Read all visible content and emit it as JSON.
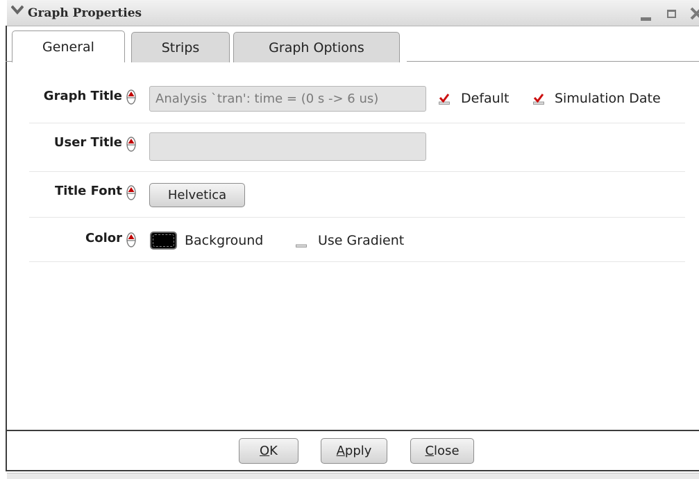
{
  "window": {
    "title": "Graph Properties",
    "menu_icon": "chevron-down-icon",
    "controls": [
      "minimize-icon",
      "maximize-icon",
      "close-icon"
    ]
  },
  "tabs": [
    {
      "label": "General",
      "active": true
    },
    {
      "label": "Strips",
      "active": false
    },
    {
      "label": "Graph Options",
      "active": false
    }
  ],
  "general": {
    "graph_title": {
      "label": "Graph Title",
      "value": "Analysis `tran': time = (0 s -> 6 us)",
      "default_label": "Default",
      "default_checked": true,
      "sim_date_label": "Simulation Date",
      "sim_date_checked": true
    },
    "user_title": {
      "label": "User Title",
      "value": ""
    },
    "title_font": {
      "label": "Title Font",
      "button_label": "Helvetica"
    },
    "color": {
      "label": "Color",
      "swatch": "#000000",
      "background_label": "Background",
      "gradient_label": "Use Gradient",
      "gradient_checked": false
    }
  },
  "buttons": {
    "ok": {
      "prefix": "",
      "underlined": "O",
      "rest": "K"
    },
    "apply": {
      "prefix": "",
      "underlined": "A",
      "rest": "pply"
    },
    "close": {
      "prefix": "",
      "underlined": "C",
      "rest": "lose"
    }
  },
  "colors": {
    "checkmark": "#cc1010",
    "spin_accent": "#c00000"
  }
}
